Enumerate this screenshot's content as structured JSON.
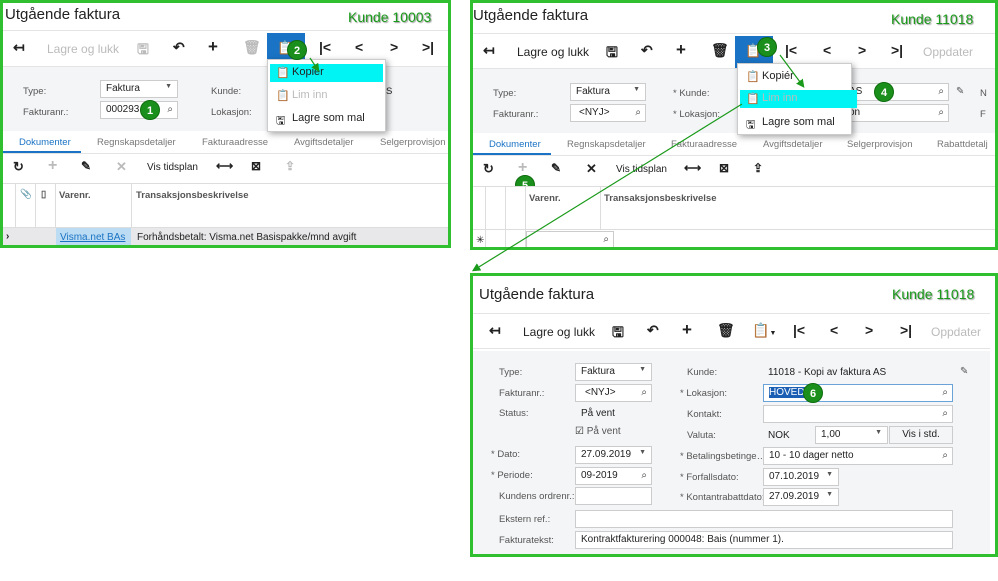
{
  "panel1": {
    "title": "Utgående faktura",
    "annotation": "Kunde 10003",
    "toolbar": {
      "save_close": "Lagre og lukk"
    },
    "menu": {
      "copy": "Kopiér",
      "paste": "Lim inn",
      "save_template": "Lagre som mal"
    },
    "form": {
      "type_label": "Type:",
      "type_value": "Faktura",
      "invoice_no_label": "Fakturanr.:",
      "invoice_no_value": "000293",
      "customer_label": "Kunde:",
      "location_label": "Lokasjon:",
      "customer_partial": "S"
    },
    "tabs": [
      "Dokumenter",
      "Regnskapsdetaljer",
      "Fakturaadresse",
      "Avgiftsdetaljer",
      "Selgerprovisjon"
    ],
    "grid_toolbar": {
      "schedule": "Vis tidsplan"
    },
    "grid": {
      "col_item": "Varenr.",
      "col_desc": "Transaksjonsbeskrivelse",
      "rows": [
        {
          "item": "Visma.net BAs",
          "desc": "Forhåndsbetalt: Visma.net Basispakke/mnd avgift"
        }
      ]
    },
    "steps": [
      "1",
      "2"
    ]
  },
  "panel2": {
    "title": "Utgående faktura",
    "annotation": "Kunde 11018",
    "toolbar": {
      "save_close": "Lagre og lukk",
      "update": "Oppdater"
    },
    "menu": {
      "copy": "Kopiér",
      "paste": "Lim inn",
      "save_template": "Lagre som mal"
    },
    "form": {
      "type_label": "Type:",
      "type_value": "Faktura",
      "invoice_no_label": "Fakturanr.:",
      "invoice_no_value": "<NYJ>",
      "customer_label": "Kunde:",
      "location_label": "Lokasjon:",
      "customer_partial": "AS",
      "location_partial": "on",
      "right_label_1": "N",
      "right_label_2": "F"
    },
    "tabs": [
      "Dokumenter",
      "Regnskapsdetaljer",
      "Fakturaadresse",
      "Avgiftsdetaljer",
      "Selgerprovisjon",
      "Rabattdetalj"
    ],
    "grid_toolbar": {
      "schedule": "Vis tidsplan"
    },
    "grid": {
      "col_item": "Varenr.",
      "col_desc": "Transaksjonsbeskrivelse"
    },
    "steps": [
      "3",
      "4",
      "5"
    ]
  },
  "panel3": {
    "title": "Utgående faktura",
    "annotation": "Kunde 11018",
    "toolbar": {
      "save_close": "Lagre og lukk",
      "update": "Oppdater"
    },
    "form": {
      "type_label": "Type:",
      "type_value": "Faktura",
      "invoice_no_label": "Fakturanr.:",
      "invoice_no_value": "<NYJ>",
      "status_label": "Status:",
      "status_value": "På vent",
      "hold_label": "På vent",
      "hold_checked": true,
      "date_label": "Dato:",
      "date_value": "27.09.2019",
      "period_label": "Periode:",
      "period_value": "09-2019",
      "order_no_label": "Kundens ordrenr.:",
      "order_no_value": "",
      "customer_label": "Kunde:",
      "customer_value": "11018 - Kopi av faktura AS",
      "location_label": "Lokasjon:",
      "location_value": "HOVED",
      "contact_label": "Kontakt:",
      "contact_value": "",
      "currency_label": "Valuta:",
      "currency_value": "NOK",
      "rate_value": "1,00",
      "std_button": "Vis i std.",
      "terms_label": "Betalingsbetinge…",
      "terms_value": "10 - 10 dager netto",
      "due_label": "Forfallsdato:",
      "due_value": "07.10.2019",
      "discount_label": "Kontantrabattdato:",
      "discount_value": "27.09.2019",
      "ext_ref_label": "Ekstern ref.:",
      "ext_ref_value": "",
      "invoice_text_label": "Fakturatekst:",
      "invoice_text_value": "Kontraktfakturering 000048: Bais (nummer 1)."
    },
    "steps": [
      "6"
    ]
  },
  "colors": {
    "annotation_border": "#2fbf2f",
    "step_badge": "#1b8f1b",
    "accent": "#1a73c4",
    "menu_highlight": "#00f4f4"
  }
}
